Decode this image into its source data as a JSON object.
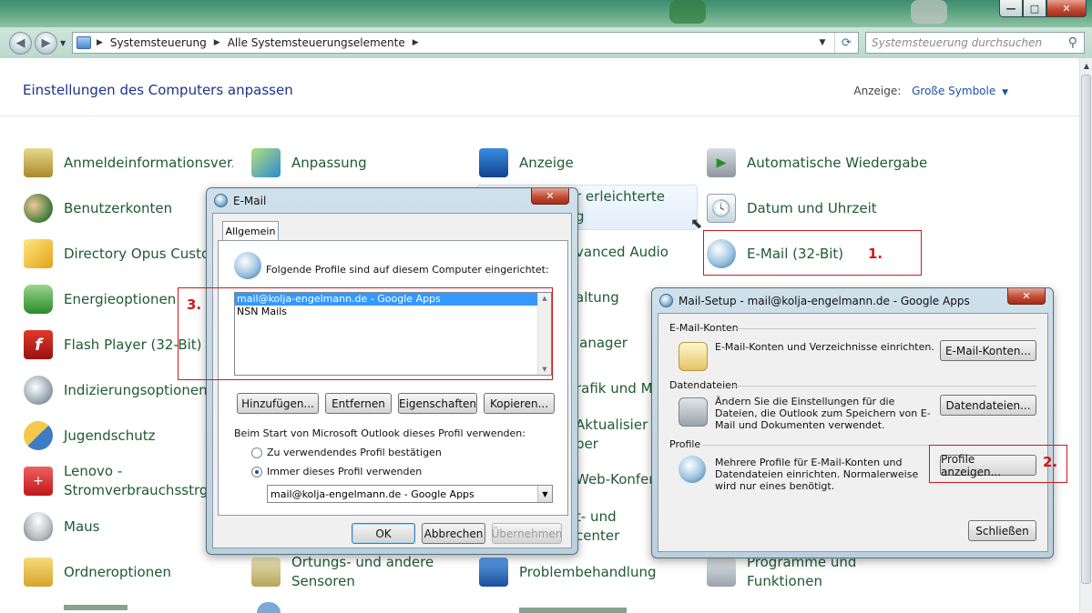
{
  "window": {
    "close_label": "✕",
    "minimize_label": "—",
    "maximize_label": "□"
  },
  "address": {
    "crumbs": [
      "Systemsteuerung",
      "Alle Systemsteuerungselemente"
    ],
    "search_placeholder": "Systemsteuerung durchsuchen"
  },
  "header": {
    "title": "Einstellungen des Computers anpassen",
    "view_label": "Anzeige:",
    "view_value": "Große Symbole"
  },
  "items": {
    "c1": [
      "Anmeldeinformationsver...",
      "Benutzerkonten",
      "Directory Opus Custom",
      "Energieoptionen",
      "Flash Player (32-Bit)",
      "Indizierungsoptionen",
      "Jugendschutz",
      "Lenovo - Stromverbrauchsstrg.",
      "Maus",
      "Ordneroptionen"
    ],
    "c2": [
      "Anpassung",
      "Ortungs- und andere Sensoren"
    ],
    "c3": [
      "Anzeige",
      "r erleichterte",
      "g",
      "vanced Audio",
      "altung",
      "lanager",
      "rafik und Me",
      "Aktualisier",
      "ber",
      "Web-Konfere",
      "t- und",
      "center",
      "Problembehandlung"
    ],
    "c4": [
      "Automatische Wiedergabe",
      "Datum und Uhrzeit",
      "E-Mail (32-Bit)",
      "Programme und Funktionen"
    ]
  },
  "annotations": [
    "1.",
    "2.",
    "3."
  ],
  "email_dialog": {
    "title": "E-Mail",
    "tab": "Allgemein",
    "intro": "Folgende Profile sind auf diesem Computer eingerichtet:",
    "profiles": [
      "mail@kolja-engelmann.de - Google Apps",
      "NSN Mails"
    ],
    "buttons": [
      "Hinzufügen...",
      "Entfernen",
      "Eigenschaften",
      "Kopieren..."
    ],
    "startup_label": "Beim Start von Microsoft Outlook dieses Profil verwenden:",
    "radio_confirm": "Zu verwendendes Profil bestätigen",
    "radio_always": "Immer dieses Profil verwenden",
    "selected_profile": "mail@kolja-engelmann.de - Google Apps",
    "ok": "OK",
    "cancel": "Abbrechen",
    "apply": "Übernehmen"
  },
  "setup_dialog": {
    "title": "Mail-Setup - mail@kolja-engelmann.de - Google Apps",
    "group_accounts": "E-Mail-Konten",
    "accounts_text": "E-Mail-Konten und Verzeichnisse einrichten.",
    "accounts_btn": "E-Mail-Konten...",
    "group_files": "Datendateien",
    "files_text": "Ändern Sie die Einstellungen für die Dateien, die Outlook zum Speichern von E-Mail und Dokumenten verwendet.",
    "files_btn": "Datendateien...",
    "group_profiles": "Profile",
    "profiles_text": "Mehrere Profile für E-Mail-Konten und Datendateien einrichten. Normalerweise wird nur eines benötigt.",
    "profiles_btn": "Profile anzeigen...",
    "close_btn": "Schließen"
  }
}
